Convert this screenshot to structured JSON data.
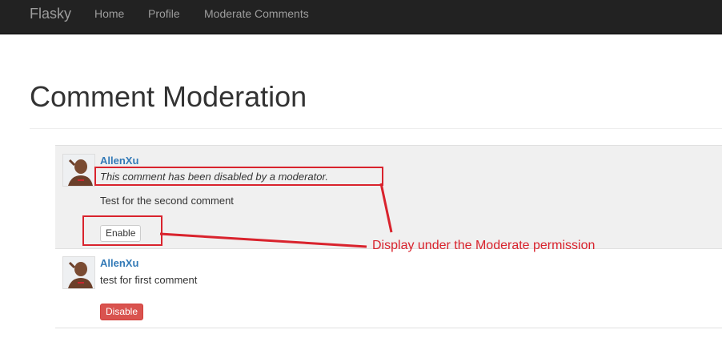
{
  "navbar": {
    "brand": "Flasky",
    "links": [
      "Home",
      "Profile",
      "Moderate Comments"
    ]
  },
  "page": {
    "title": "Comment Moderation"
  },
  "comments": [
    {
      "author": "AllenXu",
      "notice": "This comment has been disabled by a moderator.",
      "body": "Test for the second comment",
      "action": "Enable"
    },
    {
      "author": "AllenXu",
      "body": "test for first comment",
      "action": "Disable"
    }
  ],
  "annotation": {
    "text": "Display under the Moderate permission"
  },
  "colors": {
    "navbar_bg": "#222222",
    "link": "#337ab7",
    "danger": "#d9534f",
    "annotation": "#d9232d"
  }
}
